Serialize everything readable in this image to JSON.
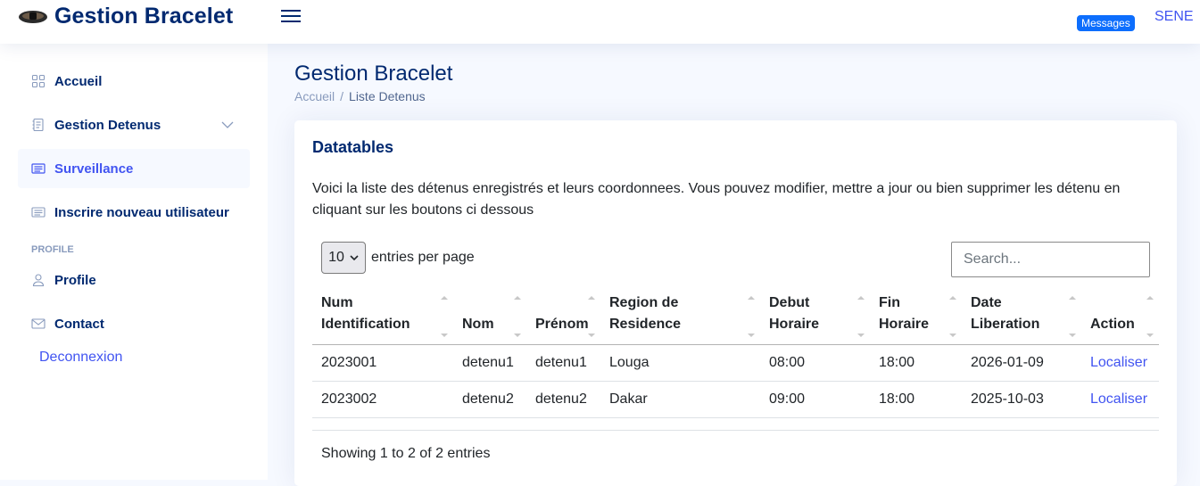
{
  "header": {
    "brand": "Gestion Bracelet",
    "messages_label": "Messages",
    "user": "SENE"
  },
  "sidebar": {
    "items": [
      {
        "label": "Accueil",
        "icon": "grid-icon"
      },
      {
        "label": "Gestion Detenus",
        "icon": "journal-icon"
      },
      {
        "label": "Surveillance",
        "icon": "layout-text-icon"
      },
      {
        "label": "Inscrire nouveau utilisateur",
        "icon": "layout-text-icon"
      }
    ],
    "heading": "PROFILE",
    "profile_label": "Profile",
    "contact_label": "Contact",
    "logout_label": "Deconnexion"
  },
  "page": {
    "title": "Gestion Bracelet",
    "breadcrumb_home": "Accueil",
    "breadcrumb_separator": "/",
    "breadcrumb_current": "Liste Detenus"
  },
  "card": {
    "title": "Datatables",
    "description": "Voici la liste des détenus enregistrés et leurs coordonnees. Vous pouvez modifier, mettre a jour ou bien supprimer les détenu en cliquant sur les boutons ci dessous",
    "per_page_value": "10",
    "per_page_label": "entries per page",
    "search_placeholder": "Search...",
    "info": "Showing 1 to 2 of 2 entries"
  },
  "table": {
    "columns": [
      "Num Identification",
      "Nom",
      "Prénom",
      "Region de Residence",
      "Debut Horaire",
      "Fin Horaire",
      "Date Liberation",
      "Action"
    ],
    "rows": [
      [
        "2023001",
        "detenu1",
        "detenu1",
        "Louga",
        "08:00",
        "18:00",
        "2026-01-09",
        "Localiser"
      ],
      [
        "2023002",
        "detenu2",
        "detenu2",
        "Dakar",
        "09:00",
        "18:00",
        "2025-10-03",
        "Localiser"
      ]
    ]
  },
  "colors": {
    "primary": "#4154f1",
    "navy": "#012970",
    "badge": "#0d6efd",
    "background": "#f6f9ff"
  }
}
